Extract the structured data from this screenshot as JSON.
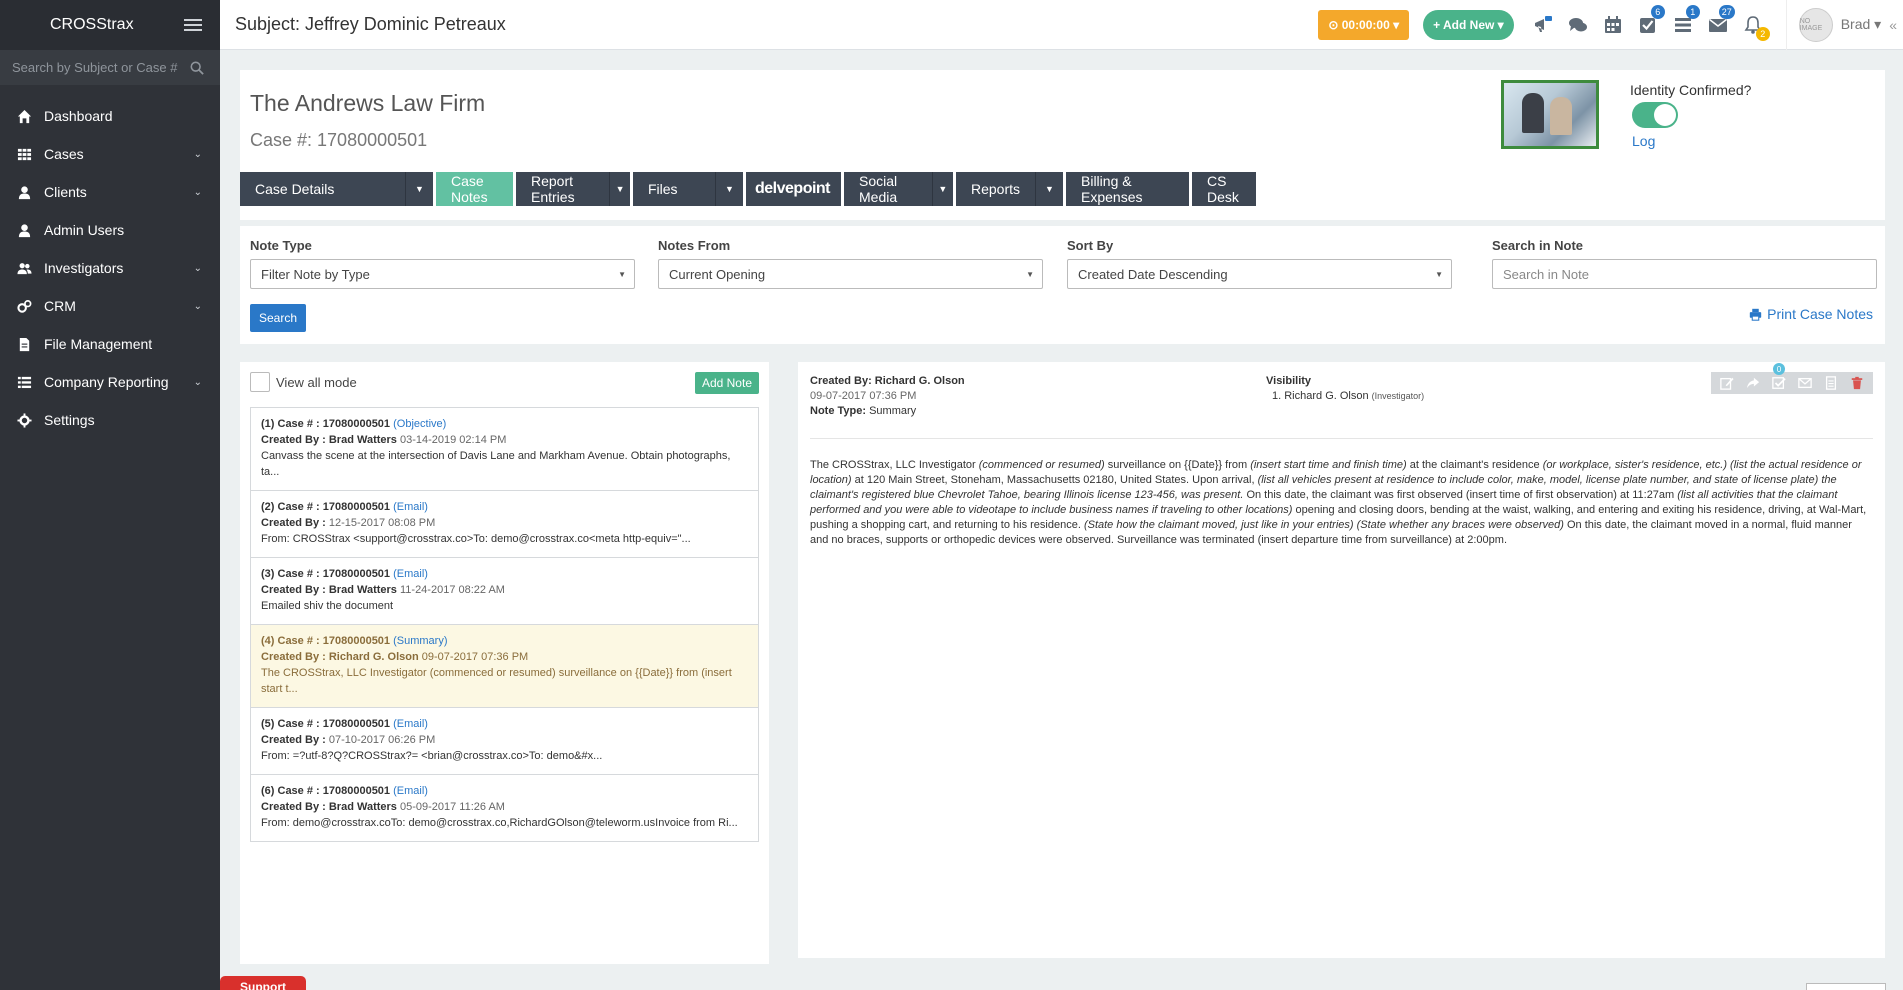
{
  "sidebar": {
    "brand": "CROSStrax",
    "search_placeholder": "Search by Subject or Case #",
    "items": [
      {
        "label": "Dashboard",
        "icon": "home-icon",
        "has_caret": false
      },
      {
        "label": "Cases",
        "icon": "grid-icon",
        "has_caret": true
      },
      {
        "label": "Clients",
        "icon": "user-icon",
        "has_caret": true
      },
      {
        "label": "Admin Users",
        "icon": "user-icon",
        "has_caret": false
      },
      {
        "label": "Investigators",
        "icon": "users-icon",
        "has_caret": true
      },
      {
        "label": "CRM",
        "icon": "cogs-icon",
        "has_caret": true
      },
      {
        "label": "File Management",
        "icon": "file-icon",
        "has_caret": false
      },
      {
        "label": "Company Reporting",
        "icon": "list-icon",
        "has_caret": true
      },
      {
        "label": "Settings",
        "icon": "gear-icon",
        "has_caret": false
      }
    ],
    "caret": "⌄"
  },
  "topbar": {
    "subject": "Subject: Jeffrey Dominic Petreaux",
    "timer": "⊙ 00:00:00 ▾",
    "add_new": "+ Add New ▾",
    "badges": {
      "tasks": "6",
      "list": "1",
      "mail": "27",
      "bell": "2"
    },
    "user_name": "Brad ▾",
    "avatar_text": "NO IMAGE",
    "collapse": "«"
  },
  "case": {
    "firm": "The Andrews Law Firm",
    "case_number": "Case #: 17080000501",
    "identity_label": "Identity Confirmed?",
    "log_label": "Log",
    "tabs": [
      {
        "label": "Case Details",
        "dropdown": true
      },
      {
        "label": "Case Notes",
        "dropdown": false
      },
      {
        "label": "Report Entries",
        "dropdown": true
      },
      {
        "label": "Files",
        "dropdown": true
      },
      {
        "label": "delvepoint",
        "dropdown": false
      },
      {
        "label": "Social Media",
        "dropdown": true
      },
      {
        "label": "Reports",
        "dropdown": true
      },
      {
        "label": "Billing & Expenses",
        "dropdown": false
      },
      {
        "label": "CS Desk",
        "dropdown": false
      }
    ],
    "dd_arrow": "▼"
  },
  "filters": {
    "note_type_label": "Note Type",
    "note_type_value": "Filter Note by Type",
    "notes_from_label": "Notes From",
    "notes_from_value": "Current Opening",
    "sort_by_label": "Sort By",
    "sort_by_value": "Created Date Descending",
    "search_label": "Search in Note",
    "search_placeholder": "Search in Note",
    "search_button": "Search",
    "print_label": "Print Case Notes",
    "arrow": "▼"
  },
  "notes": {
    "view_all": "View all mode",
    "add_note": "Add Note",
    "items": [
      {
        "case": "(1) Case # : 17080000501",
        "type": "(Objective)",
        "by_label": "Created By :",
        "by": "Brad Watters",
        "date": "03-14-2019 02:14 PM",
        "text": "Canvass the scene at the intersection of Davis Lane and Markham Avenue.  Obtain photographs, ta..."
      },
      {
        "case": "(2) Case # : 17080000501",
        "type": "(Email)",
        "by_label": "Created By :",
        "by": "",
        "date": "12-15-2017 08:08 PM",
        "text": "From: CROSStrax <support@crosstrax.co>To: demo@crosstrax.co<meta http-equiv=\"..."
      },
      {
        "case": "(3) Case # : 17080000501",
        "type": "(Email)",
        "by_label": "Created By :",
        "by": "Brad Watters",
        "date": "11-24-2017 08:22 AM",
        "text": "Emailed shiv the document"
      },
      {
        "case": "(4) Case # : 17080000501",
        "type": "(Summary)",
        "by_label": "Created By :",
        "by": "Richard G. Olson",
        "date": "09-07-2017 07:36 PM",
        "text": "The CROSStrax, LLC Investigator (commenced or resumed) surveillance on {{Date}} from (insert start t..."
      },
      {
        "case": "(5) Case # : 17080000501",
        "type": "(Email)",
        "by_label": "Created By :",
        "by": "",
        "date": "07-10-2017 06:26 PM",
        "text": "From: =?utf-8?Q?CROSStrax?= <brian@crosstrax.co>To: demo&#x..."
      },
      {
        "case": "(6) Case # : 17080000501",
        "type": "(Email)",
        "by_label": "Created By :",
        "by": "Brad Watters",
        "date": "05-09-2017 11:26 AM",
        "text": "From: demo@crosstrax.coTo: demo@crosstrax.co,RichardGOlson@teleworm.usInvoice from Ri..."
      }
    ]
  },
  "detail": {
    "created_by": "Created By: Richard G. Olson",
    "date": "09-07-2017 07:36 PM",
    "note_type_label": "Note Type:",
    "note_type": "Summary",
    "visibility_label": "Visibility",
    "visibility_item": "1. Richard G. Olson",
    "visibility_role": "(Investigator)",
    "task_badge": "0",
    "body": [
      {
        "t": "The CROSStrax, LLC Investigator ",
        "i": false
      },
      {
        "t": "(commenced or resumed)",
        "i": true
      },
      {
        "t": " surveillance on {{Date}} from ",
        "i": false
      },
      {
        "t": "(insert start time and finish time)",
        "i": true
      },
      {
        "t": " at the claimant's residence ",
        "i": false
      },
      {
        "t": "(or workplace, sister's residence, etc.) (list the actual residence or location)",
        "i": true
      },
      {
        "t": " at 120 Main Street, Stoneham, Massachusetts 02180, United States. Upon arrival, ",
        "i": false
      },
      {
        "t": "(list all vehicles present at residence to include color, make, model, license plate number, and state of license plate) the claimant's registered blue Chevrolet Tahoe, bearing Illinois license 123-456, was present.",
        "i": true
      },
      {
        "t": " On this date, the claimant was first observed (insert time of first observation) at 11:27am ",
        "i": false
      },
      {
        "t": "(list all activities that the claimant performed and you were able to videotape to include business names if traveling to other locations)",
        "i": true
      },
      {
        "t": " opening and closing doors, bending at the waist, walking, and entering and exiting his residence, driving, at Wal-Mart, pushing a shopping cart, and returning to his residence. ",
        "i": false
      },
      {
        "t": "(State how the claimant moved, just like in your entries) (State whether any braces were observed)",
        "i": true
      },
      {
        "t": " On this date, the claimant moved in a normal, fluid manner and no braces, supports or orthopedic devices were observed. Surveillance was terminated (insert departure time from surveillance) at 2:00pm.",
        "i": false
      }
    ]
  },
  "support": "Support",
  "colors": {
    "sidebar": "#2f3238",
    "accent_green": "#4ab38a",
    "tab_active": "#62c1a2",
    "tab_dark": "#3d4653",
    "link_blue": "#2a78c8",
    "timer_orange": "#f4a82b"
  }
}
